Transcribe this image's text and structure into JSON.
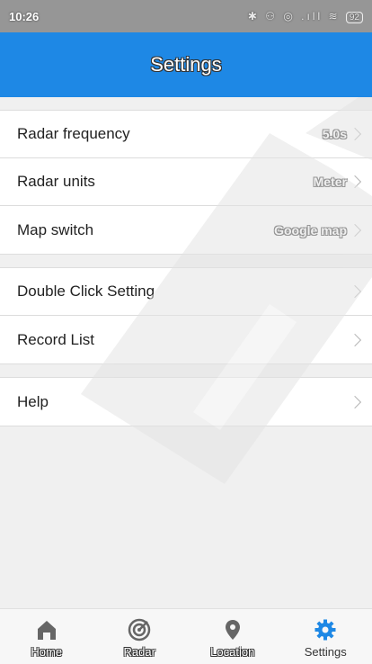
{
  "status_bar": {
    "time": "10:26",
    "icons": "✱ ⚇ ◎ .ıll ≋",
    "battery": "92"
  },
  "header": {
    "title": "Settings"
  },
  "settings": {
    "group1": [
      {
        "label": "Radar frequency",
        "value": "5.0s"
      },
      {
        "label": "Radar units",
        "value": "Meter"
      },
      {
        "label": "Map switch",
        "value": "Google map"
      }
    ],
    "group2": [
      {
        "label": "Double Click Setting",
        "value": ""
      },
      {
        "label": "Record List",
        "value": ""
      }
    ],
    "group3": [
      {
        "label": "Help",
        "value": ""
      }
    ]
  },
  "tabs": [
    {
      "label": "Home",
      "icon": "home-icon",
      "active": false
    },
    {
      "label": "Radar",
      "icon": "radar-icon",
      "active": false
    },
    {
      "label": "Location",
      "icon": "location-pin-icon",
      "active": false
    },
    {
      "label": "Settings",
      "icon": "gear-icon",
      "active": true
    }
  ],
  "colors": {
    "accent": "#1e88e5",
    "tab_inactive": "#666666",
    "watermark": "#e9e9e9"
  }
}
